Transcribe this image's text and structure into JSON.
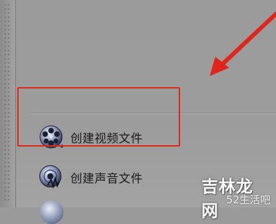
{
  "menu": {
    "items": [
      {
        "label": "创建视频文件",
        "icon": "film-reel-icon"
      },
      {
        "label": "创建声音文件",
        "icon": "audio-disc-icon"
      }
    ]
  },
  "annotation": {
    "highlight_color": "#e0251b",
    "arrow_color": "#e0251b"
  },
  "watermark": {
    "title": "吉林龙网",
    "subtitle": "52生活吧"
  }
}
